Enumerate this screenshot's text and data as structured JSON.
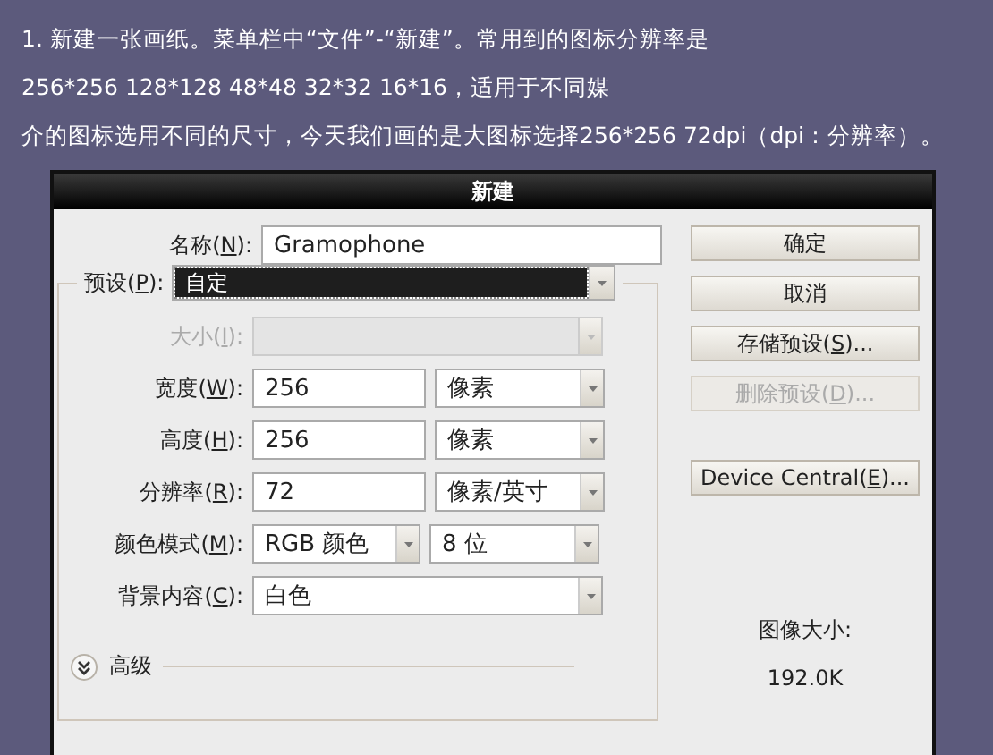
{
  "intro": [
    "1. 新建一张画纸。菜单栏中“文件”-“新建”。常用到的图标分辨率是",
    "256*256 128*128 48*48 32*32 16*16，适用于不同媒",
    "介的图标选用不同的尺寸，今天我们画的是大图标选择256*256 72dpi（dpi：分辨率）。"
  ],
  "dialog": {
    "title": "新建",
    "name_field": {
      "label": {
        "before": "名称(",
        "key": "N",
        "after": "):"
      },
      "value": "Gramophone"
    },
    "preset": {
      "label": {
        "before": "预设(",
        "key": "P",
        "after": "):"
      },
      "value": "自定",
      "focused": true
    },
    "rows": [
      {
        "kind": "select",
        "label": {
          "before": "大小(",
          "key": "I",
          "after": "):"
        },
        "disabled": true
      },
      {
        "kind": "input_select",
        "label": {
          "before": "宽度(",
          "key": "W",
          "after": "):"
        },
        "value": "256",
        "unit": "像素"
      },
      {
        "kind": "input_select",
        "label": {
          "before": "高度(",
          "key": "H",
          "after": "):"
        },
        "value": "256",
        "unit": "像素"
      },
      {
        "kind": "input_select",
        "label": {
          "before": "分辨率(",
          "key": "R",
          "after": "):"
        },
        "value": "72",
        "unit": "像素/英寸"
      },
      {
        "kind": "select_select",
        "label": {
          "before": "颜色模式(",
          "key": "M",
          "after": "):"
        },
        "value": "RGB 颜色",
        "unit": "8 位"
      },
      {
        "kind": "select",
        "label": {
          "before": "背景内容(",
          "key": "C",
          "after": "):"
        },
        "value": "白色",
        "disabled": false
      }
    ],
    "advanced": {
      "label": "高级",
      "expanded": false
    },
    "buttons": [
      {
        "label": {
          "before": "确定"
        },
        "disabled": false
      },
      {
        "label": {
          "before": "取消"
        },
        "disabled": false
      },
      {
        "label": {
          "before": "存储预设(",
          "key": "S",
          "after": ")..."
        },
        "disabled": false
      },
      {
        "label": {
          "before": "删除预设(",
          "key": "D",
          "after": ")..."
        },
        "disabled": true
      },
      {
        "label": {
          "before": "Device Central(",
          "key": "E",
          "after": ")..."
        },
        "disabled": false
      }
    ],
    "image_size": {
      "label": "图像大小:",
      "value": "192.0K"
    }
  }
}
